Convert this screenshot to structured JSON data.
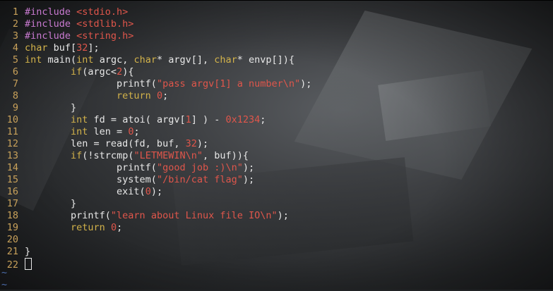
{
  "lines": [
    {
      "n": "1",
      "segs": [
        {
          "c": "p",
          "t": "#include "
        },
        {
          "c": "s",
          "t": "<stdio.h>"
        }
      ]
    },
    {
      "n": "2",
      "segs": [
        {
          "c": "p",
          "t": "#include "
        },
        {
          "c": "s",
          "t": "<stdlib.h>"
        }
      ]
    },
    {
      "n": "3",
      "segs": [
        {
          "c": "p",
          "t": "#include "
        },
        {
          "c": "s",
          "t": "<string.h>"
        }
      ]
    },
    {
      "n": "4",
      "segs": [
        {
          "c": "t",
          "t": "char"
        },
        {
          "c": "",
          "t": " buf["
        },
        {
          "c": "n",
          "t": "32"
        },
        {
          "c": "",
          "t": "];"
        }
      ]
    },
    {
      "n": "5",
      "segs": [
        {
          "c": "t",
          "t": "int"
        },
        {
          "c": "",
          "t": " main("
        },
        {
          "c": "t",
          "t": "int"
        },
        {
          "c": "",
          "t": " argc, "
        },
        {
          "c": "t",
          "t": "char"
        },
        {
          "c": "",
          "t": "* argv[], "
        },
        {
          "c": "t",
          "t": "char"
        },
        {
          "c": "",
          "t": "* envp[]){"
        }
      ]
    },
    {
      "n": "6",
      "segs": [
        {
          "c": "",
          "t": "        "
        },
        {
          "c": "k",
          "t": "if"
        },
        {
          "c": "",
          "t": "(argc<"
        },
        {
          "c": "n",
          "t": "2"
        },
        {
          "c": "",
          "t": "){"
        }
      ]
    },
    {
      "n": "7",
      "segs": [
        {
          "c": "",
          "t": "                printf("
        },
        {
          "c": "s",
          "t": "\"pass argv[1] a number\\n\""
        },
        {
          "c": "",
          "t": ");"
        }
      ]
    },
    {
      "n": "8",
      "segs": [
        {
          "c": "",
          "t": "                "
        },
        {
          "c": "k",
          "t": "return"
        },
        {
          "c": "",
          "t": " "
        },
        {
          "c": "n",
          "t": "0"
        },
        {
          "c": "",
          "t": ";"
        }
      ]
    },
    {
      "n": "9",
      "segs": [
        {
          "c": "",
          "t": "        }"
        }
      ]
    },
    {
      "n": "10",
      "segs": [
        {
          "c": "",
          "t": "        "
        },
        {
          "c": "t",
          "t": "int"
        },
        {
          "c": "",
          "t": " fd = atoi( argv["
        },
        {
          "c": "n",
          "t": "1"
        },
        {
          "c": "",
          "t": "] ) - "
        },
        {
          "c": "n",
          "t": "0x1234"
        },
        {
          "c": "",
          "t": ";"
        }
      ]
    },
    {
      "n": "11",
      "segs": [
        {
          "c": "",
          "t": "        "
        },
        {
          "c": "t",
          "t": "int"
        },
        {
          "c": "",
          "t": " len = "
        },
        {
          "c": "n",
          "t": "0"
        },
        {
          "c": "",
          "t": ";"
        }
      ]
    },
    {
      "n": "12",
      "segs": [
        {
          "c": "",
          "t": "        len = read(fd, buf, "
        },
        {
          "c": "n",
          "t": "32"
        },
        {
          "c": "",
          "t": ");"
        }
      ]
    },
    {
      "n": "13",
      "segs": [
        {
          "c": "",
          "t": "        "
        },
        {
          "c": "k",
          "t": "if"
        },
        {
          "c": "",
          "t": "(!strcmp("
        },
        {
          "c": "s",
          "t": "\"LETMEWIN\\n\""
        },
        {
          "c": "",
          "t": ", buf)){"
        }
      ]
    },
    {
      "n": "14",
      "segs": [
        {
          "c": "",
          "t": "                printf("
        },
        {
          "c": "s",
          "t": "\"good job :)\\n\""
        },
        {
          "c": "",
          "t": ");"
        }
      ]
    },
    {
      "n": "15",
      "segs": [
        {
          "c": "",
          "t": "                system("
        },
        {
          "c": "s",
          "t": "\"/bin/cat flag\""
        },
        {
          "c": "",
          "t": ");"
        }
      ]
    },
    {
      "n": "16",
      "segs": [
        {
          "c": "",
          "t": "                exit("
        },
        {
          "c": "n",
          "t": "0"
        },
        {
          "c": "",
          "t": ");"
        }
      ]
    },
    {
      "n": "17",
      "segs": [
        {
          "c": "",
          "t": "        }"
        }
      ]
    },
    {
      "n": "18",
      "segs": [
        {
          "c": "",
          "t": "        printf("
        },
        {
          "c": "s",
          "t": "\"learn about Linux file IO\\n\""
        },
        {
          "c": "",
          "t": ");"
        }
      ]
    },
    {
      "n": "19",
      "segs": [
        {
          "c": "",
          "t": "        "
        },
        {
          "c": "k",
          "t": "return"
        },
        {
          "c": "",
          "t": " "
        },
        {
          "c": "n",
          "t": "0"
        },
        {
          "c": "",
          "t": ";"
        }
      ]
    },
    {
      "n": "20",
      "segs": []
    },
    {
      "n": "21",
      "segs": [
        {
          "c": "",
          "t": "}"
        }
      ]
    },
    {
      "n": "22",
      "segs": [],
      "cursor": true
    }
  ],
  "tildes": [
    "~",
    "~"
  ],
  "colors": {
    "line_number": "#c8a15a",
    "keyword": "#d2b24a",
    "string": "#e0564b",
    "preproc": "#c97ad1",
    "text": "#e8e8e8",
    "tilde": "#4e6fb0"
  }
}
